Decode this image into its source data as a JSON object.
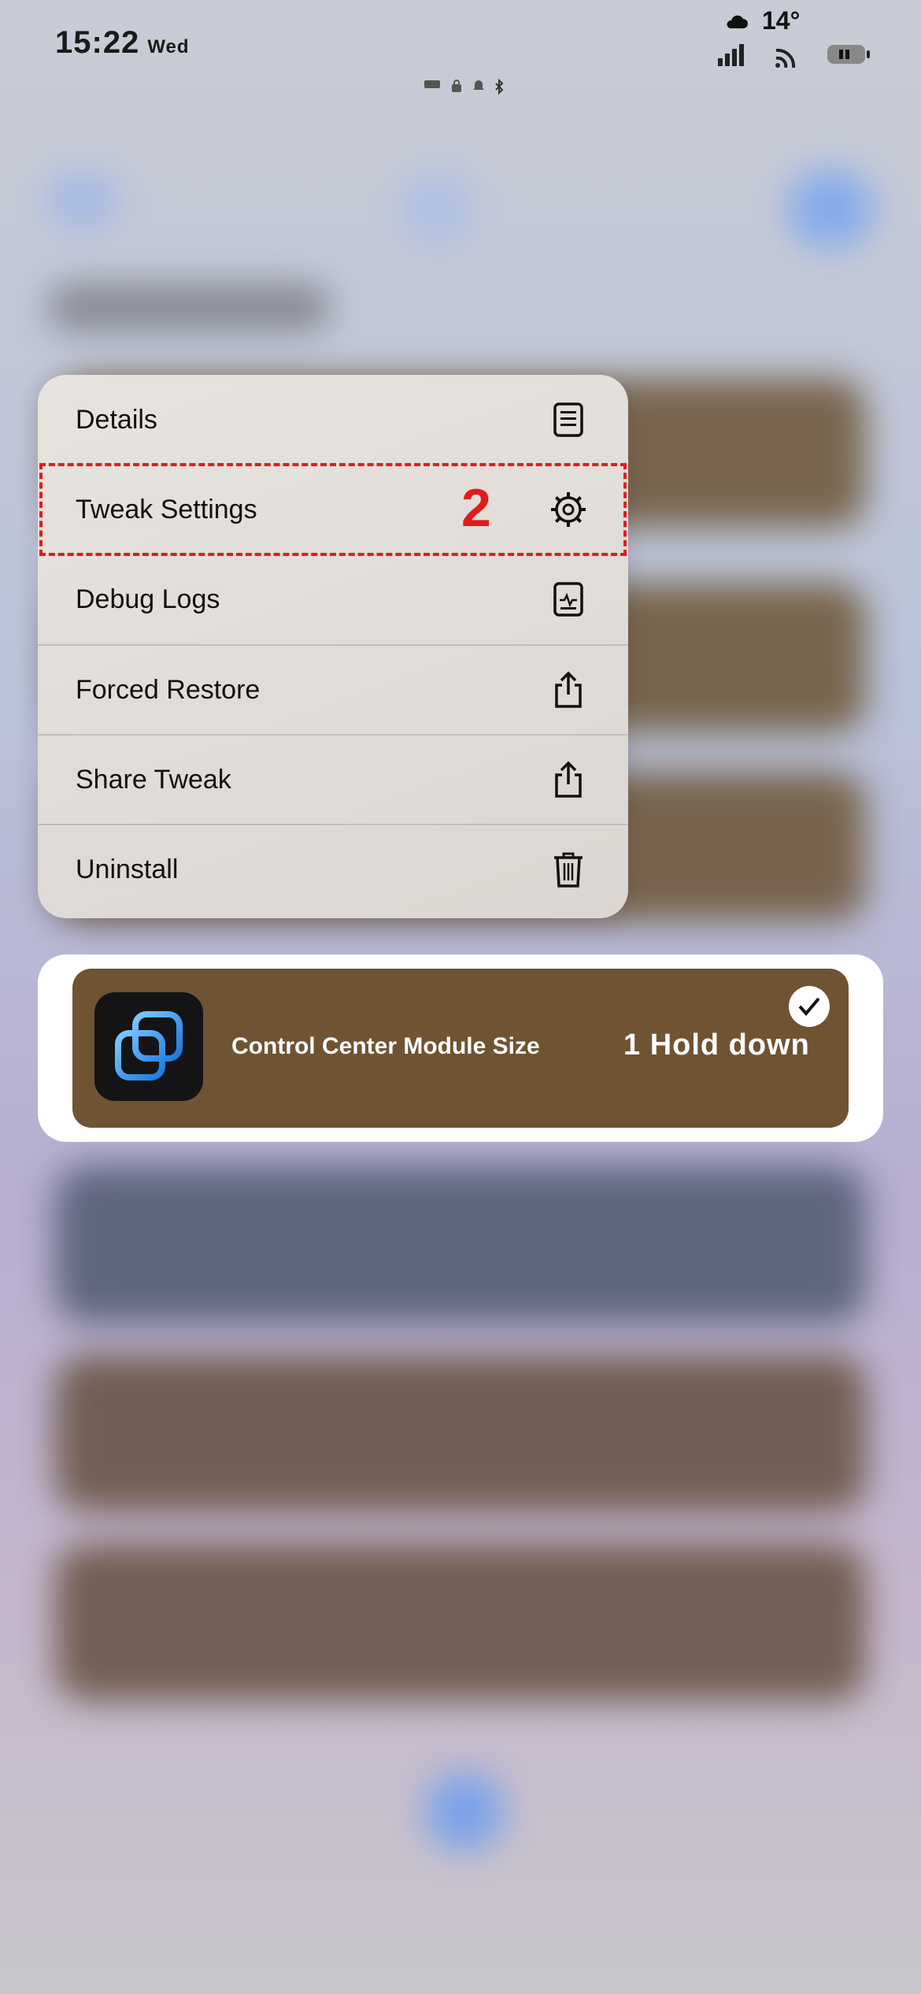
{
  "status_bar": {
    "time": "15:22",
    "day": "Wed",
    "temperature": "14°",
    "icons": [
      "vpn-icon",
      "lock-icon",
      "bell-icon",
      "bluetooth-icon",
      "cloud-icon",
      "cellular-signal-icon",
      "wifi-icon",
      "battery-icon"
    ]
  },
  "context_menu": {
    "items": [
      {
        "label": "Details",
        "icon": "document-icon"
      },
      {
        "label": "Tweak Settings",
        "icon": "gear-icon"
      },
      {
        "label": "Debug Logs",
        "icon": "log-icon"
      },
      {
        "label": "Forced Restore",
        "icon": "share-icon"
      },
      {
        "label": "Share Tweak",
        "icon": "share-icon"
      },
      {
        "label": "Uninstall",
        "icon": "trash-icon"
      }
    ]
  },
  "annotation": {
    "step_2": "2",
    "step_1": "1 Hold down",
    "highlight_color": "#e21b1b"
  },
  "preview_card": {
    "name": "Control Center Module Size",
    "card_color": "#6f5333",
    "icon": "overlapping-squares-icon"
  }
}
